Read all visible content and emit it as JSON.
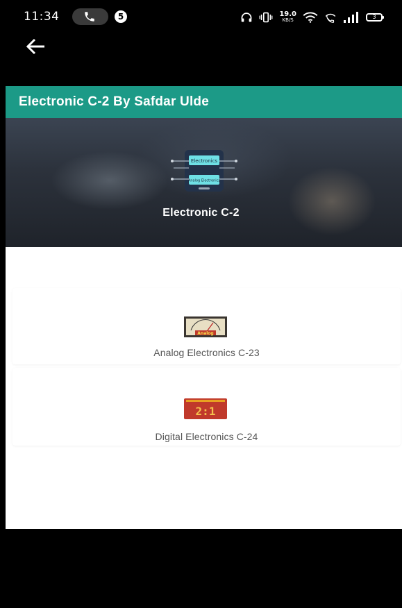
{
  "status_bar": {
    "time": "11:34",
    "notification_count": "5",
    "net_speed_value": "19.0",
    "net_speed_unit": "KB/S",
    "battery_level": "3"
  },
  "toolbar": {
    "title": "Electronic C-2 By Safdar Ulde"
  },
  "banner": {
    "title": "Electronic C-2",
    "logo_top_text": "Electronics",
    "logo_bottom_text": "Analog Electronics"
  },
  "cards": [
    {
      "label": "Analog Electronics C-23",
      "icon": "analog-meter-icon",
      "icon_text": "Analog"
    },
    {
      "label": "Digital Electronics C-24",
      "icon": "digital-display-icon",
      "icon_text": "2:1"
    }
  ],
  "colors": {
    "toolbar": "#1c9a87",
    "background": "#ffffff",
    "status_bar": "#000000",
    "card_label": "#555555"
  }
}
